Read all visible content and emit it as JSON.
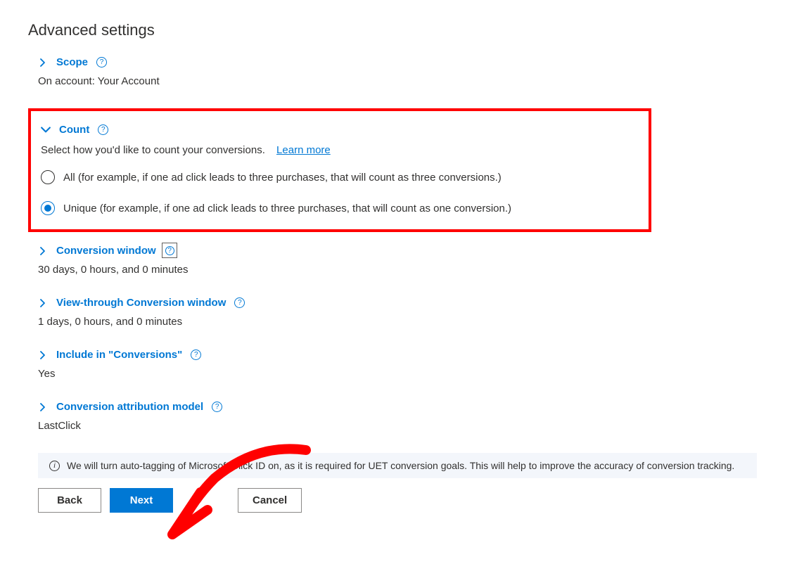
{
  "page_title": "Advanced settings",
  "sections": {
    "scope": {
      "label": "Scope",
      "value": "On account: Your Account"
    },
    "count": {
      "label": "Count",
      "description": "Select how you'd like to count your conversions.",
      "learn_more": "Learn more",
      "options": {
        "all": "All (for example, if one ad click leads to three purchases, that will count as three conversions.)",
        "unique": "Unique (for example, if one ad click leads to three purchases, that will count as one conversion.)"
      }
    },
    "conversion_window": {
      "label": "Conversion window",
      "value": "30 days, 0 hours, and 0 minutes"
    },
    "view_through": {
      "label": "View-through Conversion window",
      "value": "1 days, 0 hours, and 0 minutes"
    },
    "include_conversions": {
      "label": "Include in \"Conversions\"",
      "value": "Yes"
    },
    "attribution_model": {
      "label": "Conversion attribution model",
      "value": "LastClick"
    }
  },
  "info_banner": "We will turn auto-tagging of Microsoft Click ID on, as it is required for UET conversion goals. This will help to improve the accuracy of conversion tracking.",
  "buttons": {
    "back": "Back",
    "next": "Next",
    "cancel": "Cancel"
  }
}
